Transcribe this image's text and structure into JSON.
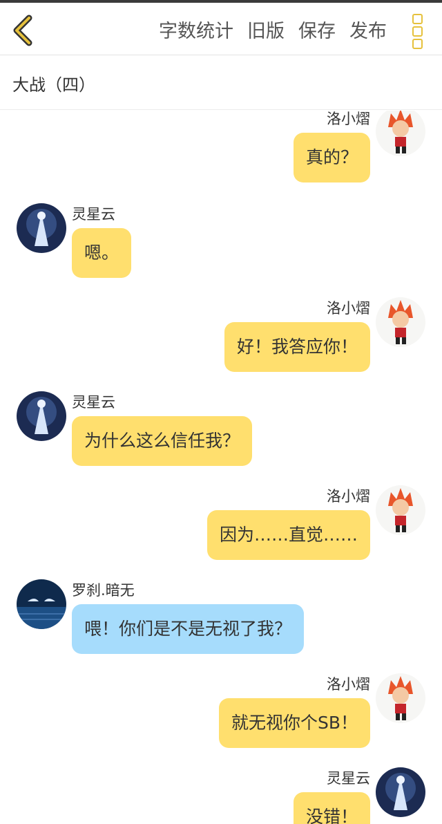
{
  "header": {
    "actions": [
      "字数统计",
      "旧版",
      "保存",
      "发布"
    ]
  },
  "title": "大战（四）",
  "messages": [
    {
      "name": "洛小熠",
      "text": "真的？"
    },
    {
      "name": "灵星云",
      "text": "嗯。"
    },
    {
      "name": "洛小熠",
      "text": "好！我答应你！"
    },
    {
      "name": "灵星云",
      "text": "为什么这么信任我？"
    },
    {
      "name": "洛小熠",
      "text": "因为……直觉……"
    },
    {
      "name": "罗刹.暗无",
      "text": "喂！你们是不是无视了我？"
    },
    {
      "name": "洛小熠",
      "text": "就无视你个SB！"
    },
    {
      "name": "灵星云",
      "text": "没错！"
    }
  ],
  "colors": {
    "bubble_yellow": "#ffdf6e",
    "bubble_blue": "#a6dcfc",
    "accent": "#e6c13c"
  },
  "icons": [
    "chevron-left-icon",
    "more-vertical-icon"
  ]
}
